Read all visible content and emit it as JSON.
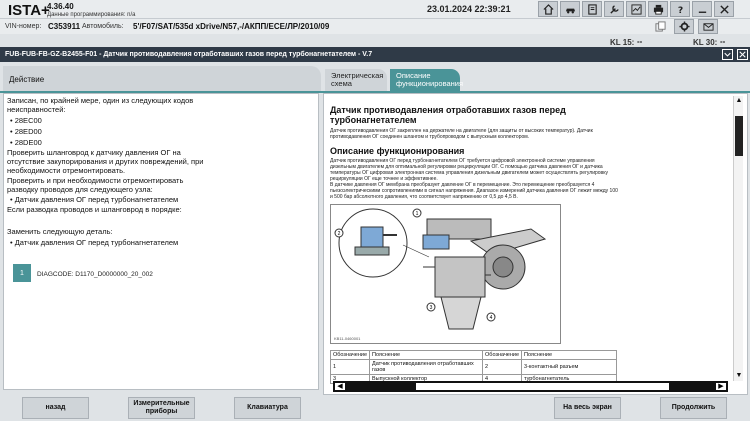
{
  "header": {
    "app_name": "ISTA+",
    "version": "4.36.40",
    "data_programming": "Данные программирования: n/a",
    "datetime": "23.01.2024 22:39:21"
  },
  "vehicle": {
    "vin_label": "VIN-номер:",
    "vin_value": "C353911",
    "car_label": "Автомобиль:",
    "car_value": "5'/F07/SAT/535d xDrive/N57,-/АКПП/ECE/ЛР/2010/09",
    "kl15_label": "KL 15:",
    "kl15_value": "--",
    "kl30_label": "KL 30:",
    "kl30_value": "--"
  },
  "window": {
    "title": "FUB-FUB-FB-GZ-B2455-F01 - Датчик противодавления отработавших газов перед турбонагнетателем - V.7"
  },
  "tabs": {
    "action": "Действие",
    "schema": "Электрическая схема",
    "description": "Описание функционирования"
  },
  "left": {
    "line1": "Записан, по крайней мере, один из следующих кодов",
    "line2": "неисправностей:",
    "codes": [
      "28EC00",
      "28ED00",
      "28DE00"
    ],
    "check1": "Проверить шланговрод к датчику давления ОГ на",
    "check2": "отсутствие закупорирования и других повреждений, при",
    "check3": "необходимости отремонтировать.",
    "check4": "Проверить и при необходимости отремонтировать",
    "check5": "разводку проводов для следующего узла:",
    "node": "Датчик давления ОГ перед турбонагнетателем",
    "ok": "Если разводка проводов и шланговрод в порядке:",
    "replace": "Заменить следующую деталь:",
    "part": "Датчик давления ОГ перед турбонагнетателем",
    "badge": "1",
    "diagcode": "DIAGCODE: D1170_D0000000_20_002"
  },
  "right": {
    "title": "Датчик противодавления отработавших газов перед турбонагнетателем",
    "intro1": "Датчик противодавления ОГ закреплен на держателе на двигателе (для защиты от высоких температур). Датчик",
    "intro2": "противодавления ОГ соединен шлангом и трубопроводом с выпускным коллектором.",
    "section": "Описание функционирования",
    "p1": "Датчик противодавления ОГ перед турбонагнетателем ОГ требуется цифровой электронной системе управления",
    "p2": "дизельным двигателем для оптимальной регулировки рециркуляции ОГ. С помощью датчика давления ОГ и датчика",
    "p3": "температуры ОГ цифровая электронная система управления дизельным двигателем может осуществлять регулировку",
    "p4": "рециркуляции ОГ еще точнее и эффективнее.",
    "p5": "В датчике давления ОГ мембрана преобразует давление ОГ в перемещение. Это перемещение преобразуется 4",
    "p6": "пьезоэлектрическими сопротивлениями в сигнал напряжения. Диапазон измерений датчика давления ОГ лежит между 100",
    "p7": "и 500 бар абсолютного давления, что соответствует напряжению от 0,5 до 4,5 В.",
    "figure_code": "KB11-0460001",
    "callouts": [
      "1",
      "2",
      "3",
      "4"
    ],
    "legend_headers": [
      "Обозначение",
      "Пояснение",
      "Обозначение",
      "Пояснение"
    ],
    "legend_rows": [
      [
        "1",
        "Датчик противодавления отработавших газов",
        "2",
        "3-контактный разъем"
      ],
      [
        "3",
        "Выпускной коллектор",
        "4",
        "турбонагнетатель"
      ]
    ]
  },
  "buttons": {
    "back": "назад",
    "measure": "Измерительные приборы",
    "keyboard": "Клавиатура",
    "fullscreen": "На весь экран",
    "continue": "Продолжить"
  }
}
